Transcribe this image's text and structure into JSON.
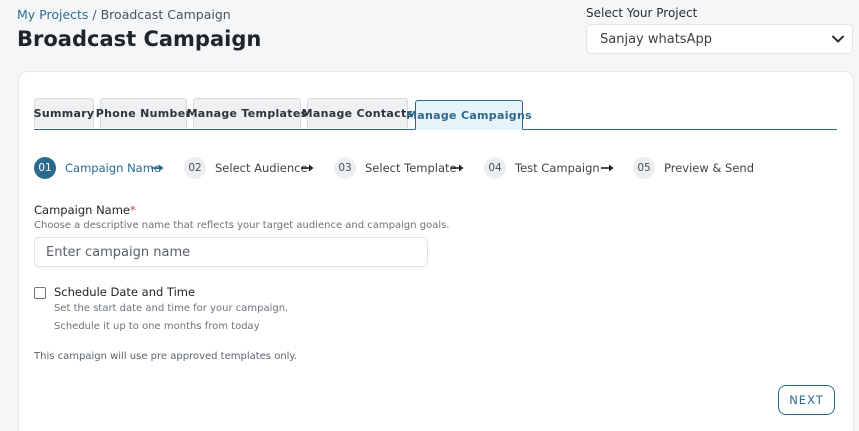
{
  "breadcrumb": {
    "link": "My Projects",
    "separator": " / ",
    "current": "Broadcast Campaign"
  },
  "page_title": "Broadcast Campaign",
  "project_select": {
    "label": "Select Your Project",
    "value": "Sanjay whatsApp",
    "icon": "chevron-down-icon"
  },
  "tabs": [
    {
      "label": "Summary",
      "active": false
    },
    {
      "label": "Phone Number",
      "active": false
    },
    {
      "label": "Manage Templates",
      "active": false
    },
    {
      "label": "Manage Contacts",
      "active": false
    },
    {
      "label": "Manage Campaigns",
      "active": true
    }
  ],
  "steps": [
    {
      "num": "01",
      "label": "Campaign Name",
      "active": true
    },
    {
      "num": "02",
      "label": "Select Audience",
      "active": false
    },
    {
      "num": "03",
      "label": "Select Template",
      "active": false
    },
    {
      "num": "04",
      "label": "Test Campaign",
      "active": false
    },
    {
      "num": "05",
      "label": "Preview & Send",
      "active": false
    }
  ],
  "campaign_name": {
    "label": "Campaign Name",
    "required_mark": "*",
    "help": "Choose a descriptive name that reflects your target audience and campaign goals.",
    "placeholder": "Enter campaign name",
    "value": ""
  },
  "schedule": {
    "label": "Schedule Date and Time",
    "checked": false,
    "help_line1": "Set the start date and time for your campaign.",
    "help_line2": "Schedule it up to one months from today"
  },
  "note": "This campaign will use pre approved templates only.",
  "next_label": "NEXT",
  "colors": {
    "accent": "#2a6a8f",
    "active_tab_bg": "#e6f3fb",
    "required": "#d04040"
  }
}
